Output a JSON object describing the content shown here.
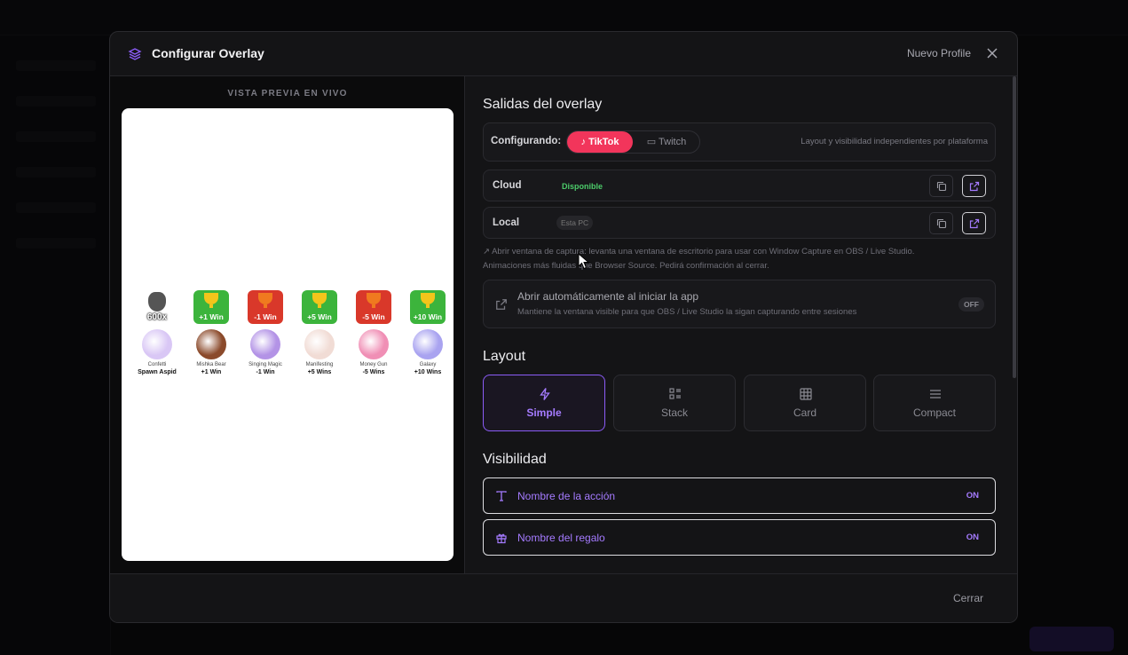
{
  "modal": {
    "title": "Configurar Overlay",
    "profile": "Nuevo Profile",
    "close_label": "Cerrar"
  },
  "preview": {
    "label": "VISTA PREVIA EN VIVO",
    "combo_text": "600x",
    "columns": [
      {
        "badge": "",
        "badge_color": "",
        "gift_name": "Confetti",
        "sub": "Spawn Aspid",
        "gift_color": "#d9c7f5"
      },
      {
        "badge": "+1 Win",
        "badge_color": "green",
        "gift_name": "Mishka Bear",
        "sub": "+1 Win",
        "gift_color": "#8b4a2b"
      },
      {
        "badge": "-1 Win",
        "badge_color": "red",
        "gift_name": "Singing Magic",
        "sub": "-1 Win",
        "gift_color": "#b393e6"
      },
      {
        "badge": "+5 Win",
        "badge_color": "green",
        "gift_name": "Manifesting",
        "sub": "+5 Wins",
        "gift_color": "#f1dcd5"
      },
      {
        "badge": "-5 Win",
        "badge_color": "red",
        "gift_name": "Money Gun",
        "sub": "-5 Wins",
        "gift_color": "#f08fb5"
      },
      {
        "badge": "+10 Win",
        "badge_color": "green",
        "gift_name": "Galaxy",
        "sub": "+10 Wins",
        "gift_color": "#a9a3f0"
      }
    ]
  },
  "outputs": {
    "title": "Salidas del overlay",
    "configuring_label": "Configurando:",
    "platforms": {
      "tiktok": "TikTok",
      "twitch": "Twitch"
    },
    "selected_platform": "TikTok",
    "hint": "Layout y visibilidad independientes por plataforma",
    "cloud": {
      "name": "Cloud",
      "status": "Disponible"
    },
    "local": {
      "name": "Local",
      "status": "Esta PC"
    },
    "note_line1": "Abrir ventana de captura: levanta una ventana de escritorio para usar con Window Capture en OBS / Live Studio.",
    "note_line2": "Animaciones más fluidas que Browser Source. Pedirá confirmación al cerrar.",
    "auto_open": {
      "title": "Abrir automáticamente al iniciar la app",
      "subtitle": "Mantiene la ventana visible para que OBS / Live Studio la sigan capturando entre sesiones",
      "state": "OFF"
    }
  },
  "layout": {
    "title": "Layout",
    "options": [
      "Simple",
      "Stack",
      "Card",
      "Compact"
    ],
    "selected": "Simple"
  },
  "visibility": {
    "title": "Visibilidad",
    "items": [
      {
        "label": "Nombre de la acción",
        "state": "ON",
        "icon": "text-icon"
      },
      {
        "label": "Nombre del regalo",
        "state": "ON",
        "icon": "gift-icon"
      }
    ]
  },
  "colors": {
    "accent": "#8b5cf6",
    "tiktok": "#f2355b",
    "available": "#4ccb6a"
  }
}
